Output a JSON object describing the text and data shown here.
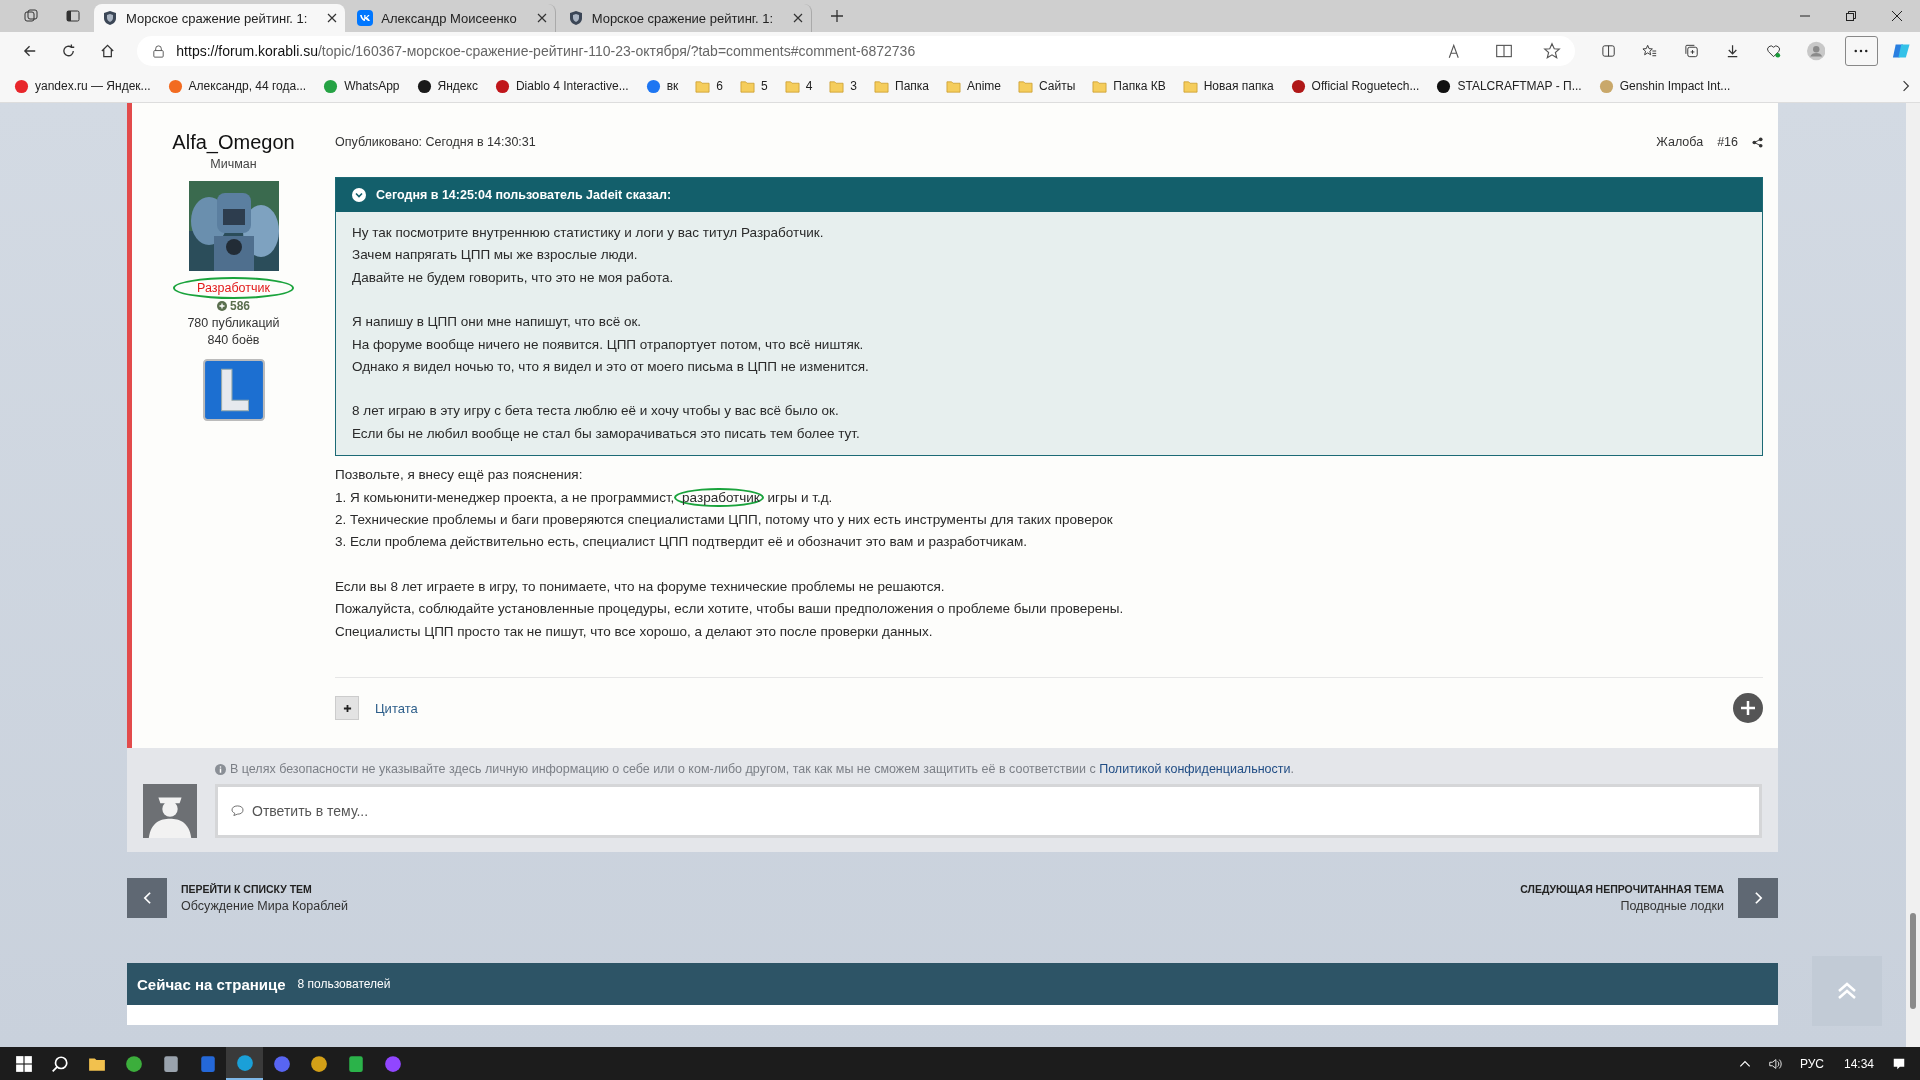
{
  "browser": {
    "tabs": [
      {
        "title": "Морское сражение рейтинг. 1:",
        "selected": true,
        "kind": "shield"
      },
      {
        "title": "Александр Моисеенко",
        "selected": false,
        "kind": "vk"
      },
      {
        "title": "Морское сражение рейтинг. 1:",
        "selected": false,
        "kind": "shield"
      }
    ],
    "address": {
      "host": "https://forum.korabli.su",
      "path": "/topic/160367-морское-сражение-рейтинг-110-23-октября/?tab=comments#comment-6872736"
    },
    "bookmarks": [
      {
        "label": "yandex.ru — Яндек...",
        "kind": "site",
        "color": "#e8262b"
      },
      {
        "label": "Александр, 44 года...",
        "kind": "site",
        "color": "#f26b21"
      },
      {
        "label": "WhatsApp",
        "kind": "site",
        "color": "#25a244"
      },
      {
        "label": "Яндекс",
        "kind": "site",
        "color": "#1a1a1a"
      },
      {
        "label": "Diablo 4 Interactive...",
        "kind": "site",
        "color": "#c0161b"
      },
      {
        "label": "вк",
        "kind": "site",
        "color": "#1e76f2"
      },
      {
        "label": "6",
        "kind": "folder"
      },
      {
        "label": "5",
        "kind": "folder"
      },
      {
        "label": "4",
        "kind": "folder"
      },
      {
        "label": "3",
        "kind": "folder"
      },
      {
        "label": "Папка",
        "kind": "folder"
      },
      {
        "label": "Anime",
        "kind": "folder"
      },
      {
        "label": "Сайты",
        "kind": "folder"
      },
      {
        "label": "Папка КВ",
        "kind": "folder"
      },
      {
        "label": "Новая папка",
        "kind": "folder"
      },
      {
        "label": "Official Roguetech...",
        "kind": "site",
        "color": "#b01818"
      },
      {
        "label": "STALCRAFTMAP - П...",
        "kind": "site",
        "color": "#111111"
      },
      {
        "label": "Genshin Impact Int...",
        "kind": "site",
        "color": "#c9a86a"
      }
    ]
  },
  "post": {
    "author": {
      "name": "Alfa_Omegon",
      "rank": "Мичман",
      "title": "Разработчик",
      "title_circled": true,
      "reputation": "586",
      "posts": "780 публикаций",
      "battles": "840 боёв"
    },
    "published": "Опубликовано: Сегодня в 14:30:31",
    "report": "Жалоба",
    "number": "#16",
    "quote": {
      "header": "Сегодня в 14:25:04 пользователь Jadeit сказал:",
      "paragraphs": [
        [
          "Ну так посмотрите внутреннюю статистику и логи у вас титул Разработчик.",
          "Зачем напрягать ЦПП мы же взрослые люди.",
          "Давайте не будем говорить, что это не моя работа."
        ],
        [
          "Я напишу в ЦПП они мне напишут, что всё ок.",
          "На форуме вообще ничего не появится. ЦПП отрапортует потом, что всё ништяк.",
          "Однако я видел ночью то, что я видел и это от моего письма в ЦПП не изменится."
        ],
        [
          "8 лет играю в эту игру с бета теста люблю её и хочу чтобы у вас всё было ок.",
          "Если бы не любил вообще не стал бы заморачиваться это писать тем более тут."
        ]
      ]
    },
    "body": [
      [
        [
          {
            "text": "Позвольте, я внесу ещё раз пояснения:",
            "circled": false
          }
        ],
        [
          {
            "text": "1. Я комьюнити-менеджер проекта, а не программист,",
            "circled": false
          },
          {
            "text": " разработчик",
            "circled": true
          },
          {
            "text": " игры и т.д.",
            "circled": false
          }
        ],
        [
          {
            "text": "2. Технические проблемы и баги проверяются специалистами ЦПП, потому что у них есть инструменты для таких проверок",
            "circled": false
          }
        ],
        [
          {
            "text": "3. Если проблема действительно есть, специалист ЦПП подтвердит её и обозначит это вам и разработчикам.",
            "circled": false
          }
        ]
      ],
      [
        [
          {
            "text": "Если вы 8 лет играете в игру, то понимаете, что на форуме технические проблемы не решаются.",
            "circled": false
          }
        ],
        [
          {
            "text": "Пожалуйста, соблюдайте установленные процедуры, если хотите, чтобы ваши предположения о проблеме были проверены.",
            "circled": false
          }
        ],
        [
          {
            "text": "Специалисты ЦПП просто так не пишут, что все хорошо, а делают это после проверки данных.",
            "circled": false
          }
        ]
      ]
    ],
    "quote_button": "Цитата"
  },
  "reply": {
    "notice": "В целях безопасности не указывайте здесь личную информацию о себе или о ком-либо другом, так как мы не сможем защитить её в соответствии с",
    "notice_link": "Политикой конфиденциальности",
    "notice_end": ".",
    "placeholder": "Ответить в тему..."
  },
  "nav": {
    "prev_label": "ПЕРЕЙТИ К СПИСКУ ТЕМ",
    "prev_title": "Обсуждение Мира Кораблей",
    "next_label": "СЛЕДУЮЩАЯ НЕПРОЧИТАННАЯ ТЕМА",
    "next_title": "Подводные лодки"
  },
  "online": {
    "title": "Сейчас на странице",
    "count": "8 пользователей"
  },
  "taskbar": {
    "apps": [
      {
        "kind": "folder",
        "color": "#f2c14e",
        "selected": false
      },
      {
        "kind": "circle",
        "color": "#3cae3c",
        "selected": false
      },
      {
        "kind": "square",
        "color": "#9aa3ad",
        "selected": false
      },
      {
        "kind": "square",
        "color": "#2468d8",
        "selected": false
      },
      {
        "kind": "circle",
        "color": "#1aa0d8",
        "selected": true
      },
      {
        "kind": "circle",
        "color": "#5865f2",
        "selected": false
      },
      {
        "kind": "circle",
        "color": "#d4a017",
        "selected": false
      },
      {
        "kind": "square",
        "color": "#2bb34a",
        "selected": false
      },
      {
        "kind": "circle",
        "color": "#9146ff",
        "selected": false
      }
    ],
    "language": "РУС",
    "time": "14:34"
  }
}
